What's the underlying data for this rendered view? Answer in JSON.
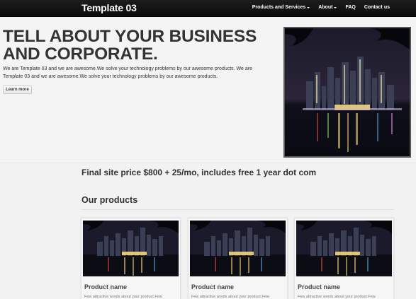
{
  "navbar": {
    "brand": "Template 03",
    "items": [
      {
        "label": "Products and Services",
        "dropdown": true
      },
      {
        "label": "About",
        "dropdown": true
      },
      {
        "label": "FAQ",
        "dropdown": false
      },
      {
        "label": "Contact us",
        "dropdown": false
      }
    ]
  },
  "hero": {
    "title": "TELL ABOUT YOUR BUSINESS AND CORPORATE.",
    "text": "We are Template 03 and we are awesome.We solve your technology problems by our awesome products. We are Template 03 and we are awesome.We solve your technology problems by our awesome products.",
    "button_label": "Learn more",
    "image": "night-city-skyline-image"
  },
  "price_line": "Final site price $800 + 25/mo, includes free 1 year dot com",
  "products": {
    "heading": "Our products",
    "items": [
      {
        "title": "Product name",
        "text": "Few attractive words about your product.Few",
        "image": "night-city-skyline-image"
      },
      {
        "title": "Product name",
        "text": "Few attractive words about your product.Few",
        "image": "night-city-skyline-image"
      },
      {
        "title": "Product name",
        "text": "Few attractive words about your product.Few",
        "image": "night-city-skyline-image"
      }
    ]
  },
  "colors": {
    "navbar_bg": "#111111",
    "page_bg": "#f2f2f2",
    "text": "#333333"
  }
}
